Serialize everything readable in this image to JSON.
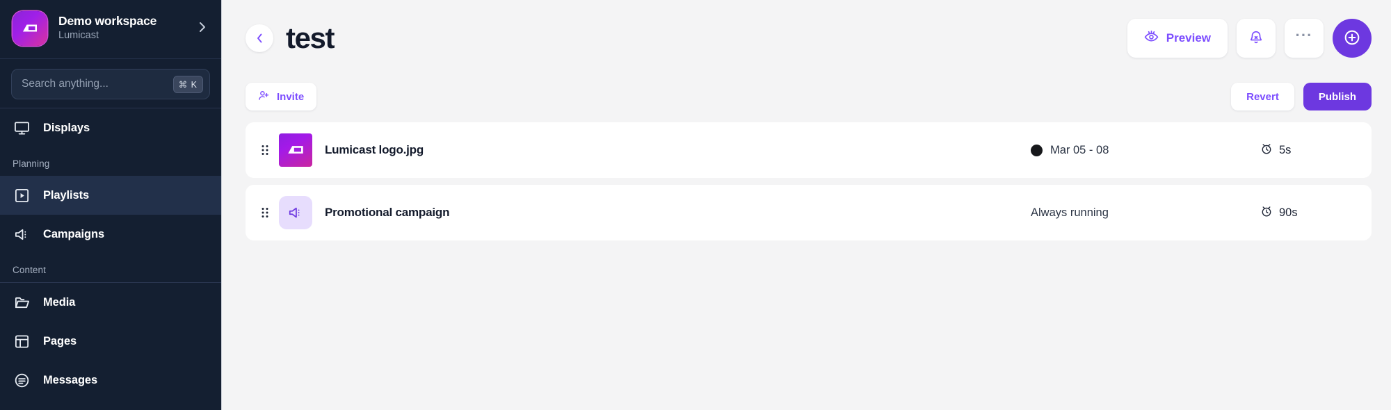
{
  "sidebar": {
    "workspace": {
      "name": "Demo workspace",
      "product": "Lumicast",
      "logo_icon": "lumicast-screen-logo",
      "expand_icon": "chevron-right-icon"
    },
    "search": {
      "placeholder": "Search anything...",
      "shortcut": "⌘ K",
      "icon": "search-input"
    },
    "items": [
      {
        "label": "Displays",
        "icon": "monitor-icon",
        "active": false
      },
      {
        "label": "Playlists",
        "icon": "play-square-icon",
        "active": true
      },
      {
        "label": "Campaigns",
        "icon": "megaphone-icon",
        "active": false
      },
      {
        "label": "Media",
        "icon": "folder-icon",
        "active": false
      },
      {
        "label": "Pages",
        "icon": "layout-icon",
        "active": false
      },
      {
        "label": "Messages",
        "icon": "message-circle-icon",
        "active": false
      }
    ],
    "sections": {
      "planning": "Planning",
      "content": "Content"
    }
  },
  "header": {
    "back_icon": "chevron-left-icon",
    "title": "test",
    "preview_label": "Preview",
    "preview_icon": "eye-icon",
    "notification_icon": "bell-off-icon",
    "more_label": "···",
    "add_icon": "plus-circle-icon"
  },
  "subbar": {
    "invite_label": "Invite",
    "invite_icon": "user-plus-icon",
    "revert_label": "Revert",
    "publish_label": "Publish"
  },
  "rows": [
    {
      "name": "Lumicast logo.jpg",
      "thumb_type": "image",
      "thumb_icon": "lumicast-screen-logo",
      "schedule": "Mar 05 - 08",
      "has_schedule_dot": true,
      "duration": "5s",
      "duration_icon": "alarm-clock-icon",
      "drag_icon": "drag-handle-icon"
    },
    {
      "name": "Promotional campaign",
      "thumb_type": "campaign",
      "thumb_icon": "megaphone-icon",
      "schedule": "Always running",
      "has_schedule_dot": false,
      "duration": "90s",
      "duration_icon": "alarm-clock-icon",
      "drag_icon": "drag-handle-icon"
    }
  ],
  "colors": {
    "sidebar_bg": "#141f31",
    "sidebar_active": "#22304a",
    "accent_purple": "#6d38e0",
    "accent_purple_text": "#7c4dff",
    "page_bg": "#f4f4f5",
    "card_bg": "#ffffff",
    "title_dark": "#131a2b"
  }
}
